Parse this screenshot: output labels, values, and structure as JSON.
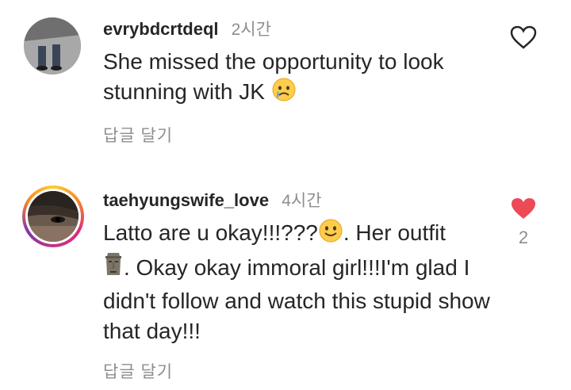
{
  "comments": [
    {
      "username": "evrybdcrtdeql",
      "time": "2시간",
      "text_parts": [
        "She missed the opportunity to look stunning with JK "
      ],
      "reply_label": "답글 달기",
      "liked": false,
      "like_count": ""
    },
    {
      "username": "taehyungswife_love",
      "time": "4시간",
      "text_a": "Latto are u okay!!!???",
      "text_b": ". Her outfit ",
      "text_c": ". Okay okay immoral girl!!!I'm glad I didn't follow and watch this stupid show that day!!!",
      "reply_label": "답글 달기",
      "liked": true,
      "like_count": "2"
    }
  ],
  "colors": {
    "text": "#262626",
    "muted": "#8e8e8e",
    "like_red": "#ed4956"
  },
  "icons": {
    "comment1_emoji": "crying-face-emoji",
    "comment2_emoji1": "slightly-smiling-face-emoji",
    "comment2_emoji2": "moai-emoji",
    "like": "heart-icon"
  }
}
